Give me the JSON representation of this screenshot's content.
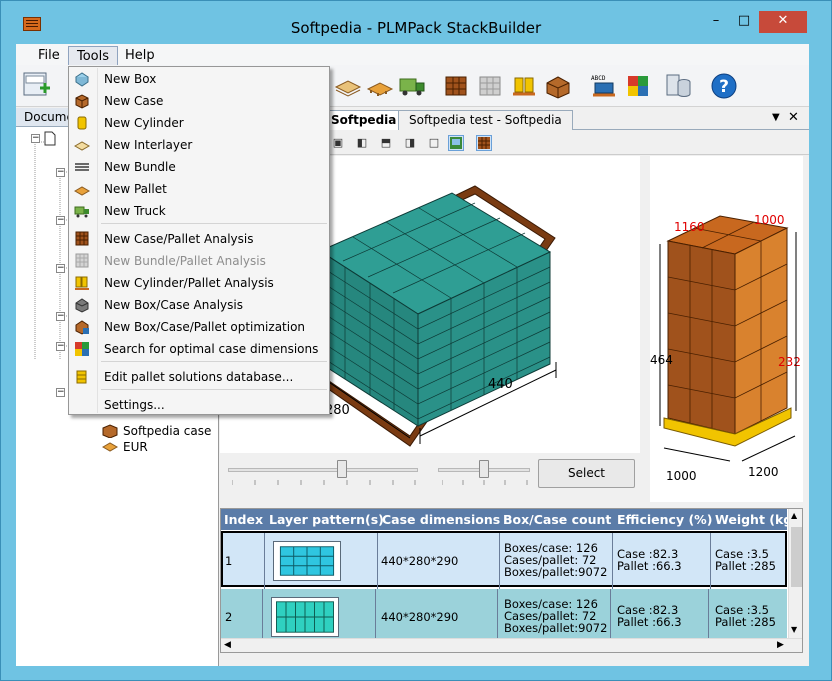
{
  "window": {
    "title": "Softpedia - PLMPack StackBuilder",
    "minimize": "–",
    "maximize": "□",
    "close": "✕"
  },
  "menubar": {
    "file": "File",
    "tools": "Tools",
    "help": "Help"
  },
  "tools_menu": {
    "items": [
      {
        "label": "New Box",
        "icon": "box-icon",
        "enabled": true
      },
      {
        "label": "New Case",
        "icon": "case-icon",
        "enabled": true
      },
      {
        "label": "New Cylinder",
        "icon": "cylinder-icon",
        "enabled": true
      },
      {
        "label": "New Interlayer",
        "icon": "interlayer-icon",
        "enabled": true
      },
      {
        "label": "New Bundle",
        "icon": "bundle-icon",
        "enabled": true
      },
      {
        "label": "New Pallet",
        "icon": "pallet-icon",
        "enabled": true
      },
      {
        "label": "New Truck",
        "icon": "truck-icon",
        "enabled": true
      },
      {
        "label": "New Case/Pallet Analysis",
        "icon": "case-pallet-analysis-icon",
        "enabled": true
      },
      {
        "label": "New Bundle/Pallet Analysis",
        "icon": "bundle-pallet-analysis-icon",
        "enabled": false
      },
      {
        "label": "New Cylinder/Pallet Analysis",
        "icon": "cylinder-pallet-analysis-icon",
        "enabled": true
      },
      {
        "label": "New Box/Case Analysis",
        "icon": "box-case-analysis-icon",
        "enabled": true
      },
      {
        "label": "New Box/Case/Pallet optimization",
        "icon": "optimization-icon",
        "enabled": true
      },
      {
        "label": "Search for optimal case dimensions",
        "icon": "search-case-icon",
        "enabled": true
      },
      {
        "label": "Edit pallet solutions database...",
        "icon": "database-icon",
        "enabled": true
      },
      {
        "label": "Settings...",
        "icon": "",
        "enabled": true
      }
    ]
  },
  "tree": {
    "header": "Docume",
    "items": [
      {
        "label": "Softpedia case",
        "icon": "case-icon"
      },
      {
        "label": "EUR",
        "icon": "pallet-icon"
      }
    ]
  },
  "tabs": {
    "active": "Softpedia",
    "second": "Softpedia test - Softpedia"
  },
  "view3d": {
    "dim_length": "440",
    "dim_width": "280"
  },
  "palletview": {
    "dims": {
      "top_left": "1160",
      "top_right": "1000",
      "left": "464",
      "right": "232",
      "bottom_left": "1000",
      "bottom_right": "1200"
    },
    "dim_color": "#e00000"
  },
  "controls": {
    "select_button": "Select",
    "slider1_value": 0.6,
    "slider2_value": 0.5
  },
  "grid": {
    "columns": [
      "Index",
      "Layer pattern(s)",
      "Case dimensions",
      "Box/Case count",
      "Efficiency (%)",
      "Weight (kg)"
    ],
    "rows": [
      {
        "index": "1",
        "case_dim": "440*280*290",
        "count": [
          "Boxes/case: 126",
          "Cases/pallet: 72",
          "Boxes/pallet:9072"
        ],
        "efficiency": [
          "Case :82.3",
          "Pallet :66.3"
        ],
        "weight": [
          "Case :3.5",
          "Pallet :285"
        ]
      },
      {
        "index": "2",
        "case_dim": "440*280*290",
        "count": [
          "Boxes/case: 126",
          "Cases/pallet: 72",
          "Boxes/pallet:9072"
        ],
        "efficiency": [
          "Case :82.3",
          "Pallet :66.3"
        ],
        "weight": [
          "Case :3.5",
          "Pallet :285"
        ]
      }
    ]
  },
  "colors": {
    "titlebar": "#6fc3e3",
    "grid_header": "#5b7ca8",
    "row_selected": "#d2e6f7",
    "box_teal": "#2f9e94",
    "pallet_brown": "#7a3b12",
    "case_orange": "#c8681f"
  }
}
